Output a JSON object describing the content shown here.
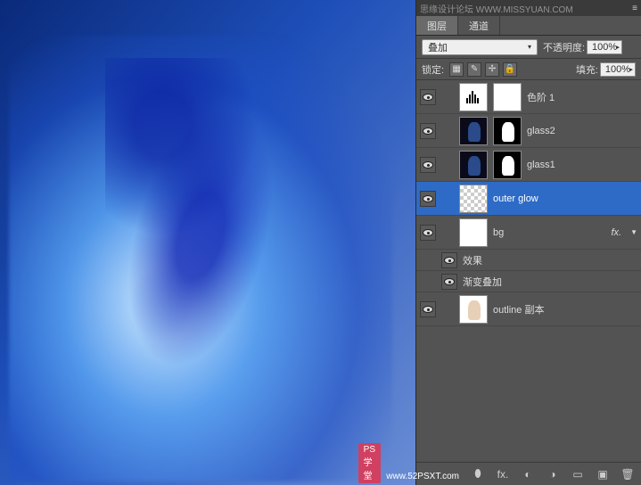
{
  "title_bar": {
    "watermark": "思缘设计论坛  WWW.MISSYUAN.COM",
    "close": "×"
  },
  "tabs": {
    "layers": "图层",
    "channels": "通道"
  },
  "options": {
    "blend_mode": "叠加",
    "opacity_label": "不透明度:",
    "opacity_value": "100%"
  },
  "lock": {
    "label": "锁定:",
    "fill_label": "填充:",
    "fill_value": "100%"
  },
  "layers": [
    {
      "name": "色阶 1",
      "type": "adjustment",
      "visible": true
    },
    {
      "name": "glass2",
      "type": "masked",
      "visible": true
    },
    {
      "name": "glass1",
      "type": "masked",
      "visible": true
    },
    {
      "name": "outer glow",
      "type": "normal",
      "visible": true,
      "selected": true
    },
    {
      "name": "bg",
      "type": "normal",
      "visible": true,
      "fx": true,
      "expanded": true
    },
    {
      "name": "outline 副本",
      "type": "normal",
      "visible": true
    }
  ],
  "effects": {
    "label": "效果",
    "gradient_overlay": "渐变叠加"
  },
  "bottom_watermark": {
    "badge": "PS学堂",
    "url": "www.52PSXT.com"
  },
  "icons": {
    "chevron_down": "▾",
    "chevron_right": "▸",
    "arrow_down": "▼",
    "link": "⬮",
    "fx": "fx.",
    "mask": "◐",
    "adjust": "◑",
    "folder": "📁",
    "new": "⬜",
    "trash": "🗑",
    "lock": "🔒",
    "plus": "✢",
    "brush": "✎",
    "checker": "▦",
    "menu": "≡"
  }
}
